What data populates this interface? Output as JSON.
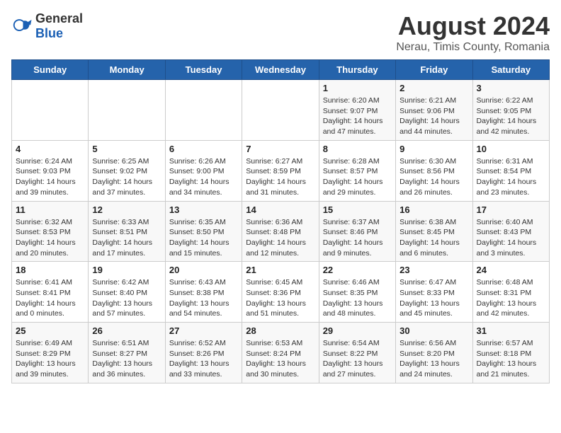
{
  "logo": {
    "general": "General",
    "blue": "Blue"
  },
  "title": "August 2024",
  "subtitle": "Nerau, Timis County, Romania",
  "days_of_week": [
    "Sunday",
    "Monday",
    "Tuesday",
    "Wednesday",
    "Thursday",
    "Friday",
    "Saturday"
  ],
  "weeks": [
    [
      {
        "day": "",
        "info": ""
      },
      {
        "day": "",
        "info": ""
      },
      {
        "day": "",
        "info": ""
      },
      {
        "day": "",
        "info": ""
      },
      {
        "day": "1",
        "info": "Sunrise: 6:20 AM\nSunset: 9:07 PM\nDaylight: 14 hours and 47 minutes."
      },
      {
        "day": "2",
        "info": "Sunrise: 6:21 AM\nSunset: 9:06 PM\nDaylight: 14 hours and 44 minutes."
      },
      {
        "day": "3",
        "info": "Sunrise: 6:22 AM\nSunset: 9:05 PM\nDaylight: 14 hours and 42 minutes."
      }
    ],
    [
      {
        "day": "4",
        "info": "Sunrise: 6:24 AM\nSunset: 9:03 PM\nDaylight: 14 hours and 39 minutes."
      },
      {
        "day": "5",
        "info": "Sunrise: 6:25 AM\nSunset: 9:02 PM\nDaylight: 14 hours and 37 minutes."
      },
      {
        "day": "6",
        "info": "Sunrise: 6:26 AM\nSunset: 9:00 PM\nDaylight: 14 hours and 34 minutes."
      },
      {
        "day": "7",
        "info": "Sunrise: 6:27 AM\nSunset: 8:59 PM\nDaylight: 14 hours and 31 minutes."
      },
      {
        "day": "8",
        "info": "Sunrise: 6:28 AM\nSunset: 8:57 PM\nDaylight: 14 hours and 29 minutes."
      },
      {
        "day": "9",
        "info": "Sunrise: 6:30 AM\nSunset: 8:56 PM\nDaylight: 14 hours and 26 minutes."
      },
      {
        "day": "10",
        "info": "Sunrise: 6:31 AM\nSunset: 8:54 PM\nDaylight: 14 hours and 23 minutes."
      }
    ],
    [
      {
        "day": "11",
        "info": "Sunrise: 6:32 AM\nSunset: 8:53 PM\nDaylight: 14 hours and 20 minutes."
      },
      {
        "day": "12",
        "info": "Sunrise: 6:33 AM\nSunset: 8:51 PM\nDaylight: 14 hours and 17 minutes."
      },
      {
        "day": "13",
        "info": "Sunrise: 6:35 AM\nSunset: 8:50 PM\nDaylight: 14 hours and 15 minutes."
      },
      {
        "day": "14",
        "info": "Sunrise: 6:36 AM\nSunset: 8:48 PM\nDaylight: 14 hours and 12 minutes."
      },
      {
        "day": "15",
        "info": "Sunrise: 6:37 AM\nSunset: 8:46 PM\nDaylight: 14 hours and 9 minutes."
      },
      {
        "day": "16",
        "info": "Sunrise: 6:38 AM\nSunset: 8:45 PM\nDaylight: 14 hours and 6 minutes."
      },
      {
        "day": "17",
        "info": "Sunrise: 6:40 AM\nSunset: 8:43 PM\nDaylight: 14 hours and 3 minutes."
      }
    ],
    [
      {
        "day": "18",
        "info": "Sunrise: 6:41 AM\nSunset: 8:41 PM\nDaylight: 14 hours and 0 minutes."
      },
      {
        "day": "19",
        "info": "Sunrise: 6:42 AM\nSunset: 8:40 PM\nDaylight: 13 hours and 57 minutes."
      },
      {
        "day": "20",
        "info": "Sunrise: 6:43 AM\nSunset: 8:38 PM\nDaylight: 13 hours and 54 minutes."
      },
      {
        "day": "21",
        "info": "Sunrise: 6:45 AM\nSunset: 8:36 PM\nDaylight: 13 hours and 51 minutes."
      },
      {
        "day": "22",
        "info": "Sunrise: 6:46 AM\nSunset: 8:35 PM\nDaylight: 13 hours and 48 minutes."
      },
      {
        "day": "23",
        "info": "Sunrise: 6:47 AM\nSunset: 8:33 PM\nDaylight: 13 hours and 45 minutes."
      },
      {
        "day": "24",
        "info": "Sunrise: 6:48 AM\nSunset: 8:31 PM\nDaylight: 13 hours and 42 minutes."
      }
    ],
    [
      {
        "day": "25",
        "info": "Sunrise: 6:49 AM\nSunset: 8:29 PM\nDaylight: 13 hours and 39 minutes."
      },
      {
        "day": "26",
        "info": "Sunrise: 6:51 AM\nSunset: 8:27 PM\nDaylight: 13 hours and 36 minutes."
      },
      {
        "day": "27",
        "info": "Sunrise: 6:52 AM\nSunset: 8:26 PM\nDaylight: 13 hours and 33 minutes."
      },
      {
        "day": "28",
        "info": "Sunrise: 6:53 AM\nSunset: 8:24 PM\nDaylight: 13 hours and 30 minutes."
      },
      {
        "day": "29",
        "info": "Sunrise: 6:54 AM\nSunset: 8:22 PM\nDaylight: 13 hours and 27 minutes."
      },
      {
        "day": "30",
        "info": "Sunrise: 6:56 AM\nSunset: 8:20 PM\nDaylight: 13 hours and 24 minutes."
      },
      {
        "day": "31",
        "info": "Sunrise: 6:57 AM\nSunset: 8:18 PM\nDaylight: 13 hours and 21 minutes."
      }
    ]
  ]
}
